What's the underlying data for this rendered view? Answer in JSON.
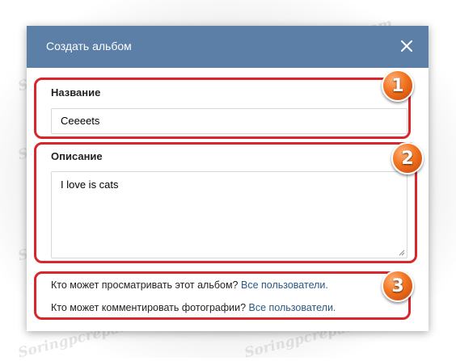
{
  "dialog": {
    "title": "Создать альбом",
    "header_color": "#5b7fa6"
  },
  "fields": {
    "name_label": "Название",
    "name_value": "Ceeeets",
    "description_label": "Описание",
    "description_value": "I love is cats"
  },
  "privacy": {
    "view_question": "Кто может просматривать этот альбом?",
    "view_value": "Все пользователи.",
    "comment_question": "Кто может комментировать фотографии?",
    "comment_value": "Все пользователи."
  },
  "annotations": {
    "badges": [
      "1",
      "2",
      "3"
    ],
    "outline_color": "#d8262c"
  },
  "watermark": "Soringpcrepair.com",
  "icons": {
    "close": "close-icon",
    "resize": "resize-grip-icon"
  }
}
